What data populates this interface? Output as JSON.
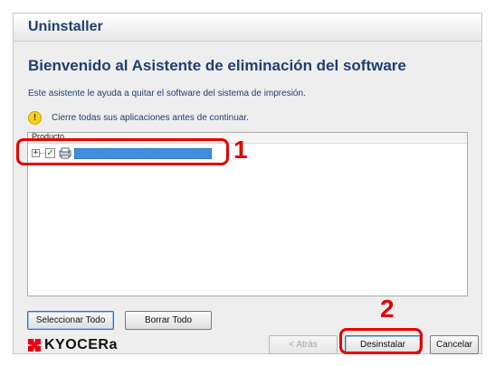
{
  "window": {
    "title": "Uninstaller"
  },
  "heading": "Bienvenido al Asistente de eliminación del software",
  "description": "Este asistente le ayuda a quitar el software del sistema de impresión.",
  "warning": {
    "icon": "warning-icon",
    "text": "Cierre todas sus aplicaciones antes de continuar."
  },
  "product_list": {
    "column_header": "Producto",
    "items": [
      {
        "checked": true,
        "expanded": false,
        "selected": true
      }
    ]
  },
  "buttons": {
    "select_all": "Seleccionar Todo",
    "clear_all": "Borrar Todo",
    "back": "< Atrás",
    "uninstall": "Desinstalar",
    "cancel": "Cancelar"
  },
  "brand": {
    "logo_text": "KYOCERa",
    "color": "#e60012"
  },
  "callouts": [
    {
      "label": "1"
    },
    {
      "label": "2"
    }
  ],
  "colors": {
    "heading": "#1f3f6f",
    "selection": "#3f8fe0",
    "callout": "#e60000"
  }
}
